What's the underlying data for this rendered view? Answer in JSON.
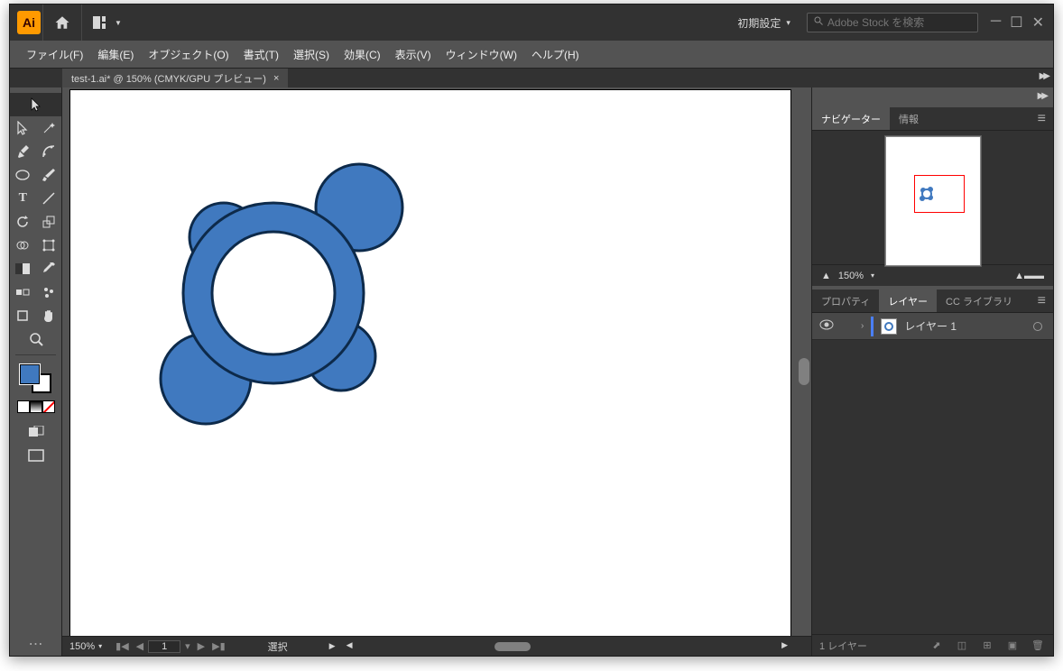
{
  "app_logo": "Ai",
  "workspace_label": "初期設定",
  "search_placeholder": "Adobe Stock を検索",
  "menus": {
    "file": "ファイル(F)",
    "edit": "編集(E)",
    "object": "オブジェクト(O)",
    "type": "書式(T)",
    "select": "選択(S)",
    "effect": "効果(C)",
    "view": "表示(V)",
    "window": "ウィンドウ(W)",
    "help": "ヘルプ(H)"
  },
  "document_tab": "test-1.ai* @ 150% (CMYK/GPU プレビュー)",
  "statusbar": {
    "zoom": "150%",
    "artboard_num": "1",
    "tool_status": "選択"
  },
  "navigator": {
    "tab_navigator": "ナビゲーター",
    "tab_info": "情報",
    "zoom": "150%"
  },
  "panels2": {
    "tab_properties": "プロパティ",
    "tab_layers": "レイヤー",
    "tab_cclib": "CC ライブラリ"
  },
  "layer": {
    "name": "レイヤー 1"
  },
  "footer": {
    "count": "1 レイヤー"
  },
  "colors": {
    "shape_fill": "#4079bf",
    "shape_stroke": "#0d2a4a"
  }
}
